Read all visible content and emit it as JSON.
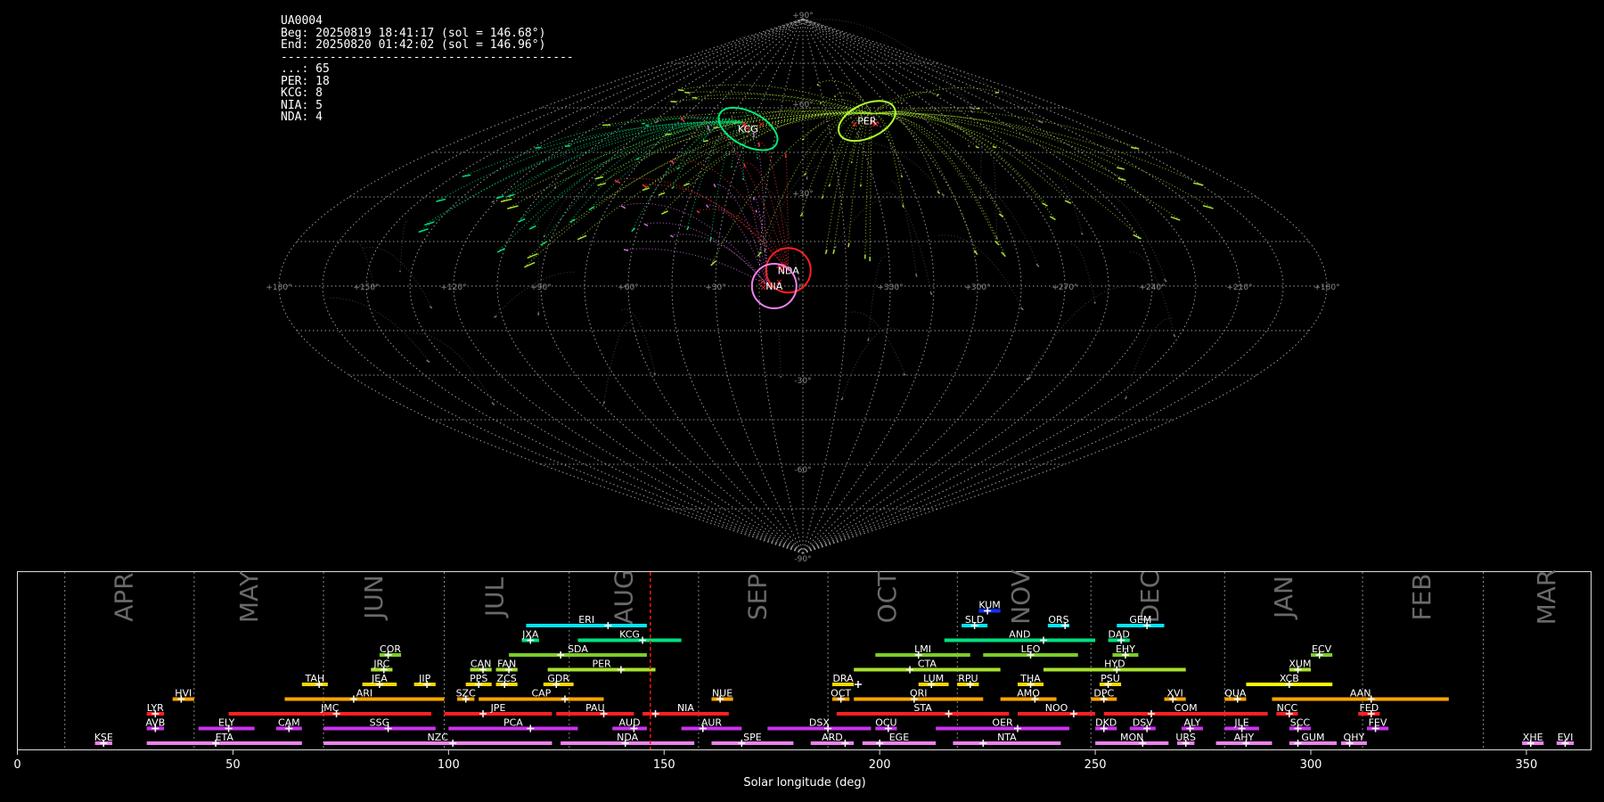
{
  "stats": {
    "lines": [
      "UA0004",
      "Beg: 20250819 18:41:17 (sol = 146.68°)",
      "End: 20250820 01:42:02 (sol = 146.96°)",
      "------------------------------------------",
      "...: 65",
      "PER: 18",
      "KCG: 8",
      "NIA: 5",
      "NDA: 4"
    ]
  },
  "chart_data": [
    {
      "type": "scatter",
      "projection": "sinusoidal",
      "grid": true,
      "lon_tick_labels": [
        "+180°",
        "+150°",
        "+120°",
        "+90°",
        "+60°",
        "+30°",
        "0°",
        "+330°",
        "+300°",
        "+270°",
        "+240°",
        "+210°",
        "+180°"
      ],
      "lat_tick_labels": [
        "+90°",
        "+60°",
        "+30°",
        "-30°",
        "-60°",
        "-90°"
      ],
      "radiants": [
        {
          "name": "PER",
          "lon": 45,
          "lat": 58,
          "color": "#adff2f"
        },
        {
          "name": "KCG",
          "lon": -35,
          "lat": 55,
          "color": "#00ee77"
        },
        {
          "name": "NDA",
          "lon": -5,
          "lat": 5,
          "color": "#ff2020"
        },
        {
          "name": "NIA",
          "lon": -12,
          "lat": 0,
          "color": "#ee82ee"
        }
      ]
    },
    {
      "type": "bar",
      "xlabel": "Solar longitude (deg)",
      "xlim": [
        0,
        365
      ],
      "xticks": [
        0,
        50,
        100,
        150,
        200,
        250,
        300,
        350
      ],
      "current_sol": 146.8,
      "months": [
        {
          "name": "APR",
          "start": 11,
          "center": 25
        },
        {
          "name": "MAY",
          "start": 41,
          "center": 54
        },
        {
          "name": "JUN",
          "start": 71,
          "center": 83
        },
        {
          "name": "JUL",
          "start": 99,
          "center": 111
        },
        {
          "name": "AUG",
          "start": 128,
          "center": 141
        },
        {
          "name": "SEP",
          "start": 158,
          "center": 172
        },
        {
          "name": "OCT",
          "start": 188,
          "center": 202
        },
        {
          "name": "NOV",
          "start": 218,
          "center": 233
        },
        {
          "name": "DEC",
          "start": 249,
          "center": 263
        },
        {
          "name": "JAN",
          "start": 280,
          "center": 294
        },
        {
          "name": "FEB",
          "start": 312,
          "center": 326
        },
        {
          "name": "MAR",
          "start": 340,
          "center": 355
        }
      ],
      "showers": [
        {
          "name": "KUM",
          "s": 223,
          "e": 228,
          "p": 225,
          "row": 10,
          "color": "#1030ff"
        },
        {
          "name": "ERI",
          "s": 118,
          "e": 146,
          "p": 137,
          "row": 9,
          "color": "#00e5ff"
        },
        {
          "name": "SLD",
          "s": 219,
          "e": 225,
          "p": 222,
          "row": 9,
          "color": "#00e5ff"
        },
        {
          "name": "ORS",
          "s": 239,
          "e": 244,
          "p": 243,
          "row": 9,
          "color": "#00e5ff"
        },
        {
          "name": "GEM",
          "s": 255,
          "e": 266,
          "p": 262,
          "row": 9,
          "color": "#00e5ff"
        },
        {
          "name": "JXA",
          "s": 117,
          "e": 121,
          "p": 119,
          "row": 8,
          "color": "#00e080"
        },
        {
          "name": "KCG",
          "s": 130,
          "e": 154,
          "p": 145,
          "row": 8,
          "color": "#00e080"
        },
        {
          "name": "AND",
          "s": 215,
          "e": 250,
          "p": 238,
          "row": 8,
          "color": "#00e080"
        },
        {
          "name": "DAD",
          "s": 253,
          "e": 258,
          "p": 256,
          "row": 8,
          "color": "#00e080"
        },
        {
          "name": "COR",
          "s": 84,
          "e": 89,
          "p": 86,
          "row": 7,
          "color": "#7ccd2a"
        },
        {
          "name": "SDA",
          "s": 114,
          "e": 146,
          "p": 126,
          "row": 7,
          "color": "#7ccd2a"
        },
        {
          "name": "LMI",
          "s": 199,
          "e": 221,
          "p": 209,
          "row": 7,
          "color": "#7ccd2a"
        },
        {
          "name": "LEO",
          "s": 224,
          "e": 246,
          "p": 235,
          "row": 7,
          "color": "#7ccd2a"
        },
        {
          "name": "EHY",
          "s": 254,
          "e": 260,
          "p": 257,
          "row": 7,
          "color": "#7ccd2a"
        },
        {
          "name": "ECV",
          "s": 300,
          "e": 305,
          "p": 302,
          "row": 7,
          "color": "#7ccd2a"
        },
        {
          "name": "JRC",
          "s": 82,
          "e": 87,
          "p": 85,
          "row": 6,
          "color": "#a8e030"
        },
        {
          "name": "CAN",
          "s": 105,
          "e": 110,
          "p": 108,
          "row": 6,
          "color": "#a8e030"
        },
        {
          "name": "FAN",
          "s": 111,
          "e": 116,
          "p": 114,
          "row": 6,
          "color": "#a8e030"
        },
        {
          "name": "PER",
          "s": 123,
          "e": 148,
          "p": 140,
          "row": 6,
          "color": "#a8e030"
        },
        {
          "name": "CTA",
          "s": 194,
          "e": 228,
          "p": 207,
          "row": 6,
          "color": "#a8e030"
        },
        {
          "name": "HYD",
          "s": 238,
          "e": 271,
          "p": 255,
          "row": 6,
          "color": "#a8e030"
        },
        {
          "name": "XUM",
          "s": 295,
          "e": 300,
          "p": 297,
          "row": 6,
          "color": "#a8e030"
        },
        {
          "name": "TAH",
          "s": 66,
          "e": 72,
          "p": 70,
          "row": 5,
          "color": "#ffd700"
        },
        {
          "name": "JEA",
          "s": 80,
          "e": 88,
          "p": 84,
          "row": 5,
          "color": "#ffd700"
        },
        {
          "name": "JIP",
          "s": 92,
          "e": 97,
          "p": 95,
          "row": 5,
          "color": "#ffd700"
        },
        {
          "name": "PPS",
          "s": 104,
          "e": 110,
          "p": 107,
          "row": 5,
          "color": "#ffd700"
        },
        {
          "name": "ZCS",
          "s": 111,
          "e": 116,
          "p": 113,
          "row": 5,
          "color": "#ffd700"
        },
        {
          "name": "GDR",
          "s": 122,
          "e": 129,
          "p": 125,
          "row": 5,
          "color": "#ffd700"
        },
        {
          "name": "DRA",
          "s": 189,
          "e": 194,
          "p": 195,
          "row": 5,
          "color": "#ffd700"
        },
        {
          "name": "LUM",
          "s": 209,
          "e": 216,
          "p": 212,
          "row": 5,
          "color": "#ffd700"
        },
        {
          "name": "RPU",
          "s": 218,
          "e": 223,
          "p": 221,
          "row": 5,
          "color": "#ffd700"
        },
        {
          "name": "THA",
          "s": 232,
          "e": 238,
          "p": 235,
          "row": 5,
          "color": "#ffd700"
        },
        {
          "name": "PSU",
          "s": 251,
          "e": 256,
          "p": 253,
          "row": 5,
          "color": "#ffd700"
        },
        {
          "name": "XCB",
          "s": 285,
          "e": 305,
          "p": 295,
          "row": 5,
          "color": "#ffff00"
        },
        {
          "name": "HVI",
          "s": 36,
          "e": 41,
          "p": 38,
          "row": 4,
          "color": "#ffa500"
        },
        {
          "name": "ARI",
          "s": 62,
          "e": 99,
          "p": 78,
          "row": 4,
          "color": "#ffa500"
        },
        {
          "name": "SZC",
          "s": 102,
          "e": 106,
          "p": 104,
          "row": 4,
          "color": "#ffa500"
        },
        {
          "name": "CAP",
          "s": 107,
          "e": 136,
          "p": 127,
          "row": 4,
          "color": "#ffa500"
        },
        {
          "name": "NUE",
          "s": 161,
          "e": 166,
          "p": 163,
          "row": 4,
          "color": "#ffa500"
        },
        {
          "name": "OCT",
          "s": 189,
          "e": 193,
          "p": 191,
          "row": 4,
          "color": "#ffa500"
        },
        {
          "name": "ORI",
          "s": 194,
          "e": 224,
          "p": 208,
          "row": 4,
          "color": "#ffa500"
        },
        {
          "name": "AMO",
          "s": 228,
          "e": 241,
          "p": 236,
          "row": 4,
          "color": "#ffa500"
        },
        {
          "name": "DPC",
          "s": 249,
          "e": 255,
          "p": 252,
          "row": 4,
          "color": "#ffa500"
        },
        {
          "name": "XVI",
          "s": 266,
          "e": 271,
          "p": 268,
          "row": 4,
          "color": "#ffa500"
        },
        {
          "name": "QUA",
          "s": 280,
          "e": 285,
          "p": 283,
          "row": 4,
          "color": "#ffa500"
        },
        {
          "name": "AAN",
          "s": 291,
          "e": 332,
          "p": 314,
          "row": 4,
          "color": "#ffa500"
        },
        {
          "name": "LYR",
          "s": 30,
          "e": 34,
          "p": 32,
          "row": 3,
          "color": "#ff2020"
        },
        {
          "name": "JMC",
          "s": 49,
          "e": 96,
          "p": 74,
          "row": 3,
          "color": "#ff2020"
        },
        {
          "name": "JPE",
          "s": 99,
          "e": 124,
          "p": 108,
          "row": 3,
          "color": "#ff2020"
        },
        {
          "name": "PAU",
          "s": 125,
          "e": 143,
          "p": 136,
          "row": 3,
          "color": "#ff2020"
        },
        {
          "name": "NIA",
          "s": 145,
          "e": 165,
          "p": 148,
          "row": 3,
          "color": "#ff2020"
        },
        {
          "name": "STA",
          "s": 190,
          "e": 230,
          "p": 216,
          "row": 3,
          "color": "#ff2020"
        },
        {
          "name": "NOO",
          "s": 232,
          "e": 250,
          "p": 245,
          "row": 3,
          "color": "#ff2020"
        },
        {
          "name": "COM",
          "s": 252,
          "e": 290,
          "p": 263,
          "row": 3,
          "color": "#ff2020"
        },
        {
          "name": "NCC",
          "s": 292,
          "e": 297,
          "p": 295,
          "row": 3,
          "color": "#ff2020"
        },
        {
          "name": "FED",
          "s": 311,
          "e": 316,
          "p": 314,
          "row": 3,
          "color": "#ff2020"
        },
        {
          "name": "AVB",
          "s": 30,
          "e": 34,
          "p": 32,
          "row": 2,
          "color": "#cc33ee"
        },
        {
          "name": "ELY",
          "s": 42,
          "e": 55,
          "p": 49,
          "row": 2,
          "color": "#cc33ee"
        },
        {
          "name": "CAM",
          "s": 60,
          "e": 66,
          "p": 63,
          "row": 2,
          "color": "#cc33ee"
        },
        {
          "name": "SSG",
          "s": 71,
          "e": 97,
          "p": 86,
          "row": 2,
          "color": "#cc33ee"
        },
        {
          "name": "PCA",
          "s": 100,
          "e": 130,
          "p": 119,
          "row": 2,
          "color": "#cc33ee"
        },
        {
          "name": "AUD",
          "s": 138,
          "e": 146,
          "p": 143,
          "row": 2,
          "color": "#cc33ee"
        },
        {
          "name": "AUR",
          "s": 154,
          "e": 168,
          "p": 159,
          "row": 2,
          "color": "#cc33ee"
        },
        {
          "name": "DSX",
          "s": 174,
          "e": 198,
          "p": 188,
          "row": 2,
          "color": "#cc33ee"
        },
        {
          "name": "OCU",
          "s": 199,
          "e": 204,
          "p": 202,
          "row": 2,
          "color": "#cc33ee"
        },
        {
          "name": "OER",
          "s": 213,
          "e": 244,
          "p": 232,
          "row": 2,
          "color": "#cc33ee"
        },
        {
          "name": "DKD",
          "s": 250,
          "e": 255,
          "p": 252,
          "row": 2,
          "color": "#cc33ee"
        },
        {
          "name": "DSV",
          "s": 258,
          "e": 264,
          "p": 262,
          "row": 2,
          "color": "#cc33ee"
        },
        {
          "name": "ALY",
          "s": 270,
          "e": 275,
          "p": 272,
          "row": 2,
          "color": "#cc33ee"
        },
        {
          "name": "JLE",
          "s": 280,
          "e": 288,
          "p": 284,
          "row": 2,
          "color": "#cc33ee"
        },
        {
          "name": "SCC",
          "s": 295,
          "e": 300,
          "p": 297,
          "row": 2,
          "color": "#cc33ee"
        },
        {
          "name": "FEV",
          "s": 313,
          "e": 318,
          "p": 315,
          "row": 2,
          "color": "#cc33ee"
        },
        {
          "name": "KSE",
          "s": 18,
          "e": 22,
          "p": 20,
          "row": 1,
          "color": "#ee82ee"
        },
        {
          "name": "ETA",
          "s": 30,
          "e": 66,
          "p": 46,
          "row": 1,
          "color": "#ee82ee"
        },
        {
          "name": "NZC",
          "s": 71,
          "e": 124,
          "p": 101,
          "row": 1,
          "color": "#ee82ee"
        },
        {
          "name": "NDA",
          "s": 126,
          "e": 157,
          "p": 141,
          "row": 1,
          "color": "#ee82ee"
        },
        {
          "name": "SPE",
          "s": 161,
          "e": 180,
          "p": 168,
          "row": 1,
          "color": "#ee82ee"
        },
        {
          "name": "ARD",
          "s": 184,
          "e": 194,
          "p": 192,
          "row": 1,
          "color": "#ee82ee"
        },
        {
          "name": "EGE",
          "s": 196,
          "e": 213,
          "p": 200,
          "row": 1,
          "color": "#ee82ee"
        },
        {
          "name": "NTA",
          "s": 217,
          "e": 242,
          "p": 224,
          "row": 1,
          "color": "#ee82ee"
        },
        {
          "name": "MON",
          "s": 250,
          "e": 267,
          "p": 261,
          "row": 1,
          "color": "#ee82ee"
        },
        {
          "name": "URS",
          "s": 269,
          "e": 273,
          "p": 271,
          "row": 1,
          "color": "#ee82ee"
        },
        {
          "name": "AHY",
          "s": 278,
          "e": 291,
          "p": 285,
          "row": 1,
          "color": "#ee82ee"
        },
        {
          "name": "GUM",
          "s": 295,
          "e": 306,
          "p": 297,
          "row": 1,
          "color": "#ee82ee"
        },
        {
          "name": "OHY",
          "s": 307,
          "e": 313,
          "p": 309,
          "row": 1,
          "color": "#ee82ee"
        },
        {
          "name": "XHE",
          "s": 349,
          "e": 354,
          "p": 351,
          "row": 1,
          "color": "#ee82ee"
        },
        {
          "name": "EVI",
          "s": 357,
          "e": 361,
          "p": 359,
          "row": 1,
          "color": "#ee82ee"
        }
      ]
    }
  ]
}
